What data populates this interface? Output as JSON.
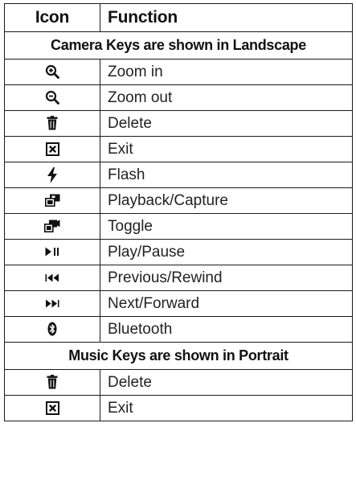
{
  "header": {
    "icon_col": "Icon",
    "function_col": "Function"
  },
  "sections": [
    {
      "title": "Camera Keys are shown in Landscape",
      "rows": [
        {
          "icon": "zoom-in-icon",
          "function": "Zoom in"
        },
        {
          "icon": "zoom-out-icon",
          "function": "Zoom out"
        },
        {
          "icon": "trash-icon",
          "function": "Delete"
        },
        {
          "icon": "exit-icon",
          "function": "Exit"
        },
        {
          "icon": "flash-icon",
          "function": "Flash"
        },
        {
          "icon": "playback-capture-icon",
          "function": "Playback/Capture"
        },
        {
          "icon": "toggle-camera-icon",
          "function": "Toggle"
        },
        {
          "icon": "play-pause-icon",
          "function": "Play/Pause"
        },
        {
          "icon": "previous-rewind-icon",
          "function": "Previous/Rewind"
        },
        {
          "icon": "next-forward-icon",
          "function": "Next/Forward"
        },
        {
          "icon": "bluetooth-icon",
          "function": "Bluetooth"
        }
      ]
    },
    {
      "title": "Music Keys are shown in Portrait",
      "rows": [
        {
          "icon": "trash-icon",
          "function": "Delete"
        },
        {
          "icon": "exit-icon",
          "function": "Exit"
        }
      ]
    }
  ]
}
